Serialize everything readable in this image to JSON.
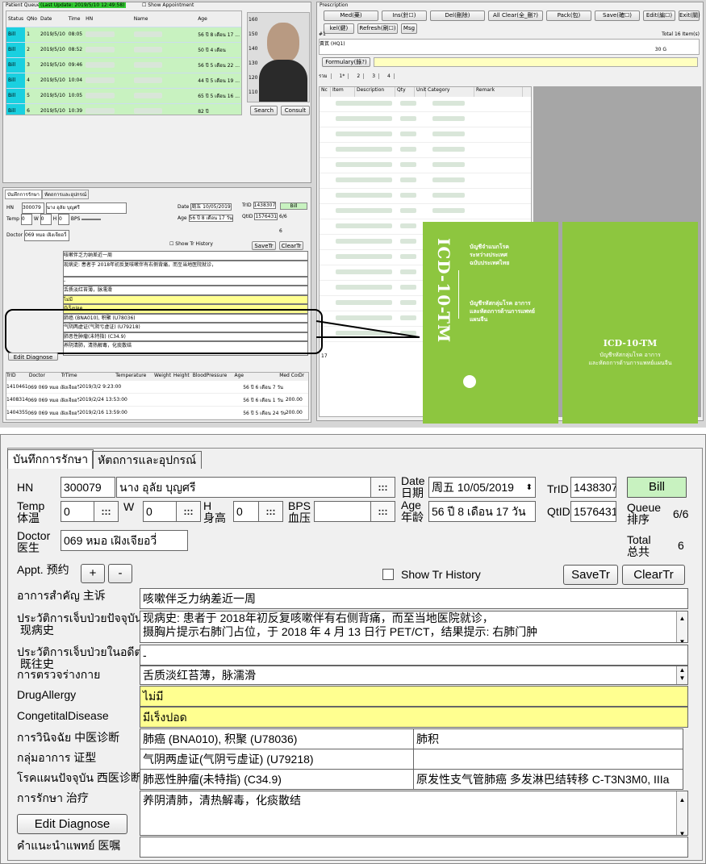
{
  "queue": {
    "title": "Patient Queue",
    "last_update": "(Last Update: 2019/5/10 12:49:58)",
    "show_appt": "Show Appointment",
    "columns": [
      "Status",
      "QNo",
      "Date",
      "Time",
      "HN",
      "Name",
      "Age"
    ],
    "rows": [
      {
        "status": "Bill",
        "qno": "1",
        "date": "2019/5/10",
        "time": "08:05",
        "age": "56 ปี 8 เดือน 17 ..."
      },
      {
        "status": "Bill",
        "qno": "2",
        "date": "2019/5/10",
        "time": "08:52",
        "age": "50 ปี 4 เดือน"
      },
      {
        "status": "Bill",
        "qno": "3",
        "date": "2019/5/10",
        "time": "09:46",
        "age": "56 ปี 5 เดือน 22 ..."
      },
      {
        "status": "Bill",
        "qno": "4",
        "date": "2019/5/10",
        "time": "10:04",
        "age": "44 ปี 5 เดือน 19 ..."
      },
      {
        "status": "Bill",
        "qno": "5",
        "date": "2019/5/10",
        "time": "10:05",
        "age": "65 ปี 5 เดือน 16 ..."
      },
      {
        "status": "Bill",
        "qno": "6",
        "date": "2019/5/10",
        "time": "10:39",
        "age": "82 ปี"
      }
    ]
  },
  "photo": {
    "search": "Search",
    "consult": "Consult",
    "ruler": [
      "160",
      "150",
      "140",
      "130",
      "120",
      "110"
    ]
  },
  "rx": {
    "title": "Prescription",
    "buttons": [
      "Med(藥)",
      "Ins(針☐)",
      "Del(刪除)",
      "All Clear(全_刪?)",
      "Pack(包)",
      "Save(確☐)",
      "Edit(編☐)",
      "Exit(關)"
    ],
    "row2": [
      "kel(鍵)",
      "Refresh(刷☐)",
      "Msg"
    ],
    "total_items": "Total 16 Item(s)",
    "no": "#1",
    "herb": "黃芪 (HQ1)",
    "qty": "30 G",
    "formulary": "Formulary(錄?)",
    "tabs": [
      "รวม",
      "1*",
      "2",
      "3",
      "4"
    ],
    "columns": [
      "Nc",
      "Item",
      "Description",
      "Qty",
      "Unit",
      "Category",
      "Remark"
    ],
    "last_no": "17"
  },
  "small": {
    "tabs": [
      "บันทึกการรักษา",
      "หัตถการและอุปกรณ์"
    ],
    "show_tr": "Show Tr History",
    "savetr": "SaveTr",
    "cleartr": "ClearTr",
    "edit_diag": "Edit Diagnose",
    "tr_cols": [
      "TrID",
      "Doctor",
      "TrTime",
      "Temperature",
      "Weight",
      "Height",
      "BloodPressure",
      "Age",
      "Med Cost",
      "Dr"
    ],
    "tr_rows": [
      {
        "id": "1410461",
        "doc": "069 069 หมอ เฝิงเจียอวี่",
        "time": "2019/3/2 9:23:00",
        "age": "56 ปี 6 เดือน 7 วัน",
        "cost": ""
      },
      {
        "id": "1408314",
        "doc": "069 069 หมอ เฝิงเจียอวี่",
        "time": "2019/2/24 13:53:00",
        "age": "56 ปี 6 เดือน 1 วัน",
        "cost": "200.00"
      },
      {
        "id": "1404355",
        "doc": "069 069 หมอ เฝิงเจียอวี่",
        "time": "2019/2/16 13:59:00",
        "age": "56 ปี 5 เดือน 24 วัน",
        "cost": "200.00"
      }
    ]
  },
  "book": {
    "left_title": "ICD-10-TM",
    "left_lines": [
      "บัญชีจำแนกโรค",
      "ระหว่างประเทศ",
      "ฉบับประเทศไทย",
      "บัญชีรหัสกลุ่มโรค อาการ",
      "และหัตถการด้านการแพทย์",
      "แผนจีน"
    ],
    "right_title": "ICD-10-TM",
    "right_lines": [
      "บัญชีรหัสกลุ่มโรค อาการ",
      "และหัตถการด้านการแพทย์แผนจีน"
    ]
  },
  "form": {
    "tabs": [
      "บันทึกการรักษา",
      "หัตถการและอุปกรณ์"
    ],
    "hn_label": "HN",
    "hn": "300079",
    "name": "นาง อุลัย บุญศรี",
    "date_label": "Date\n日期",
    "date": "周五 10/05/2019",
    "age_label": "Age\n年龄",
    "age": "56 ปี 8 เดือน 17 วัน",
    "trid_label": "TrID",
    "trid": "1438307",
    "qtid_label": "QtID",
    "qtid": "1576431",
    "bill": "Bill",
    "queue_label": "Queue\n排序",
    "queue": "6/6",
    "total_label": "Total\n总共",
    "total": "6",
    "temp_label": "Temp\n体温",
    "temp": "0",
    "w_label": "W",
    "w": "0",
    "h_label": "H\n身高",
    "h": "0",
    "bps_label": "BPS\n血压",
    "bps": "",
    "doctor_label": "Doctor\n医生",
    "doctor": "069 หมอ เฝิงเจียอวี่",
    "appt_label": "Appt. 预约",
    "plus": "+",
    "minus": "-",
    "show_tr": "Show Tr History",
    "savetr": "SaveTr",
    "cleartr": "ClearTr",
    "cc_label": "อาการสำคัญ 主诉",
    "cc": "咳嗽伴乏力纳差近一周",
    "pi_label": "ประวัติการเจ็บป่วยปัจจุบัน\n 现病史",
    "pi1": "现病史: 患者于 2018年初反复咳嗽伴有右侧背痛，而至当地医院就诊，",
    "pi2": "摄胸片提示右肺门占位，于 2018 年 4 月 13 日行 PET/CT，结果提示: 右肺门肿",
    "ph_label": "ประวัติการเจ็บป่วยในอดีต\n 既往史",
    "ph": "-",
    "pe_label": "การตรวจร่างกาย",
    "pe": "舌质淡红苔薄，脉濡滑",
    "drug_label": "DrugAllergy",
    "drug": "ไม่มี",
    "cong_label": "CongetitalDisease",
    "cong": "มีเร็งปอด",
    "dx_label": "การวินิจฉัย 中医诊断",
    "dx": "肺癌 (BNA010), 积聚 (U78036)",
    "dx2": "肺积",
    "sx_label": "กลุ่มอาการ 证型",
    "sx": "气阴两虚证(气阴亏虚证) (U79218)",
    "sx2": "",
    "wd_label": "โรคแผนปัจจุบัน 西医诊断",
    "wd": "肺恶性肿瘤(未特指) (C34.9)",
    "wd2": "原发性支气管肺癌 多发淋巴结转移 C-T3N3M0, IIIa",
    "tx_label": "การรักษา 治疗",
    "tx": "养阴清肺，清热解毒，化痰散结",
    "edit_diag": "Edit Diagnose",
    "advice_label": "คำแนะนำแพทย์ 医嘱",
    "dots": ":::"
  }
}
